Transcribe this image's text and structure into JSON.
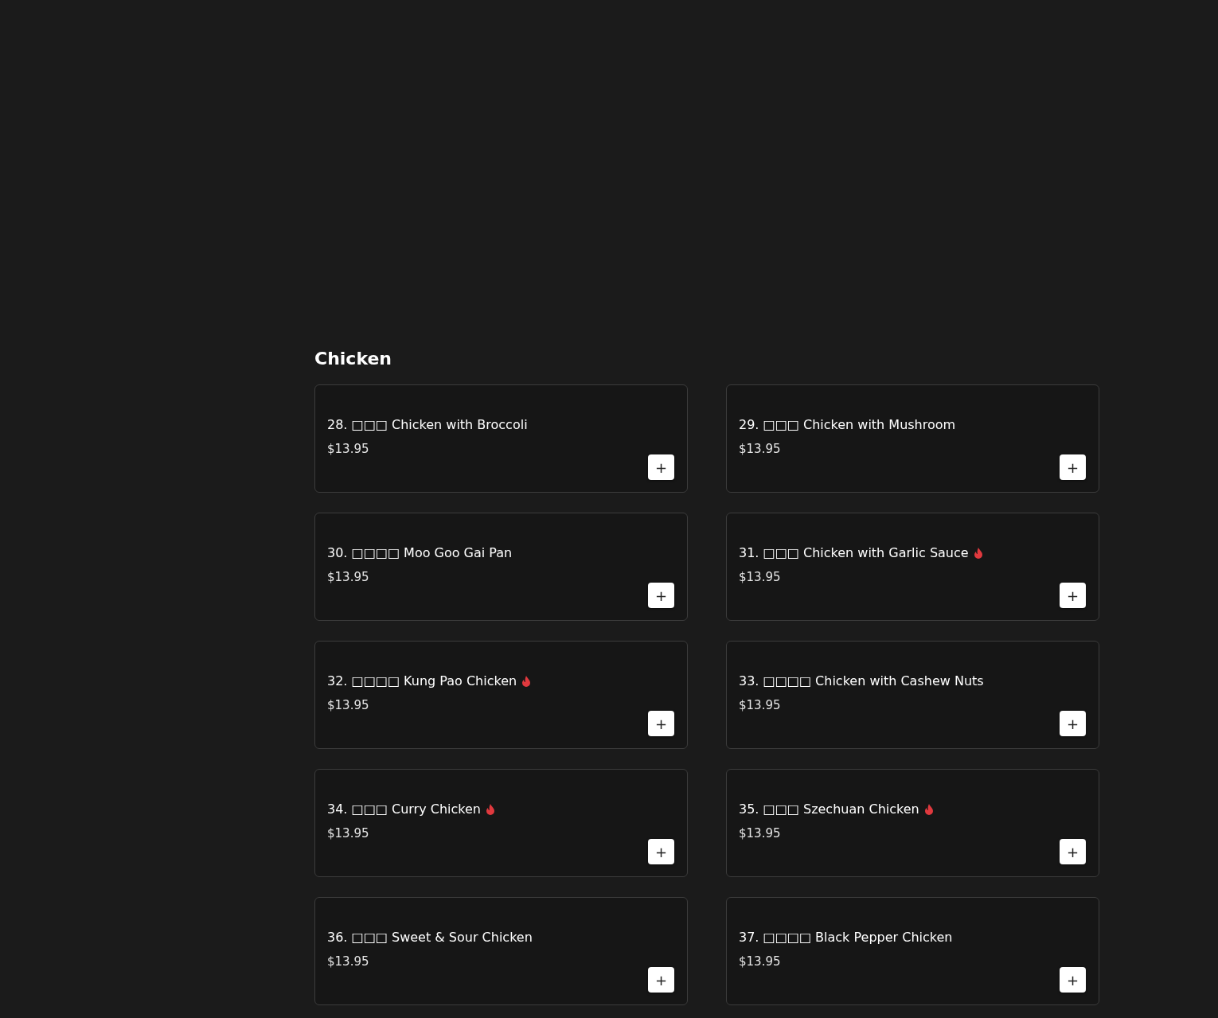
{
  "section": {
    "title": "Chicken"
  },
  "items": [
    {
      "name": "28. □□□ Chicken with Broccoli",
      "price": "$13.95",
      "spicy": false,
      "add": "+"
    },
    {
      "name": "29. □□□ Chicken with Mushroom",
      "price": "$13.95",
      "spicy": false,
      "add": "+"
    },
    {
      "name": "30. □□□□ Moo Goo Gai Pan",
      "price": "$13.95",
      "spicy": false,
      "add": "+"
    },
    {
      "name": "31. □□□ Chicken with Garlic Sauce",
      "price": "$13.95",
      "spicy": true,
      "add": "+"
    },
    {
      "name": "32. □□□□ Kung Pao Chicken",
      "price": "$13.95",
      "spicy": true,
      "add": "+"
    },
    {
      "name": "33. □□□□ Chicken with Cashew Nuts",
      "price": "$13.95",
      "spicy": false,
      "add": "+"
    },
    {
      "name": "34. □□□ Curry Chicken",
      "price": "$13.95",
      "spicy": true,
      "add": "+"
    },
    {
      "name": "35. □□□ Szechuan Chicken",
      "price": "$13.95",
      "spicy": true,
      "add": "+"
    },
    {
      "name": "36. □□□ Sweet & Sour Chicken",
      "price": "$13.95",
      "spicy": false,
      "add": "+"
    },
    {
      "name": "37. □□□□ Black Pepper Chicken",
      "price": "$13.95",
      "spicy": false,
      "add": "+"
    }
  ]
}
